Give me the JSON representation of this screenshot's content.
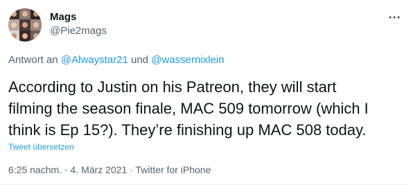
{
  "author": {
    "display_name": "Mags",
    "handle": "@Pie2mags",
    "avatar_icon": "collage-avatar-icon"
  },
  "more_icon": "more-horizontal-icon",
  "reply_to": {
    "prefix": "Antwort an",
    "mention_1": "@Alwaystar21",
    "conjunction": "und",
    "mention_2": "@wassernixlein"
  },
  "body": {
    "line_1": "According to Justin on his Patreon, they will start",
    "line_2": "filming the season finale, MAC 509 tomorrow (which I",
    "line_3": "think is Ep 15?). They’re finishing up MAC 508 today."
  },
  "translate_label": "Tweet übersetzen",
  "meta": {
    "time": "6:25 nachm.",
    "separator_1": "·",
    "date": "4. März 2021",
    "separator_2": "·",
    "source": "Twitter for iPhone"
  },
  "colors": {
    "text": "#0f1419",
    "secondary": "#536471",
    "accent": "#1d9bf0"
  }
}
